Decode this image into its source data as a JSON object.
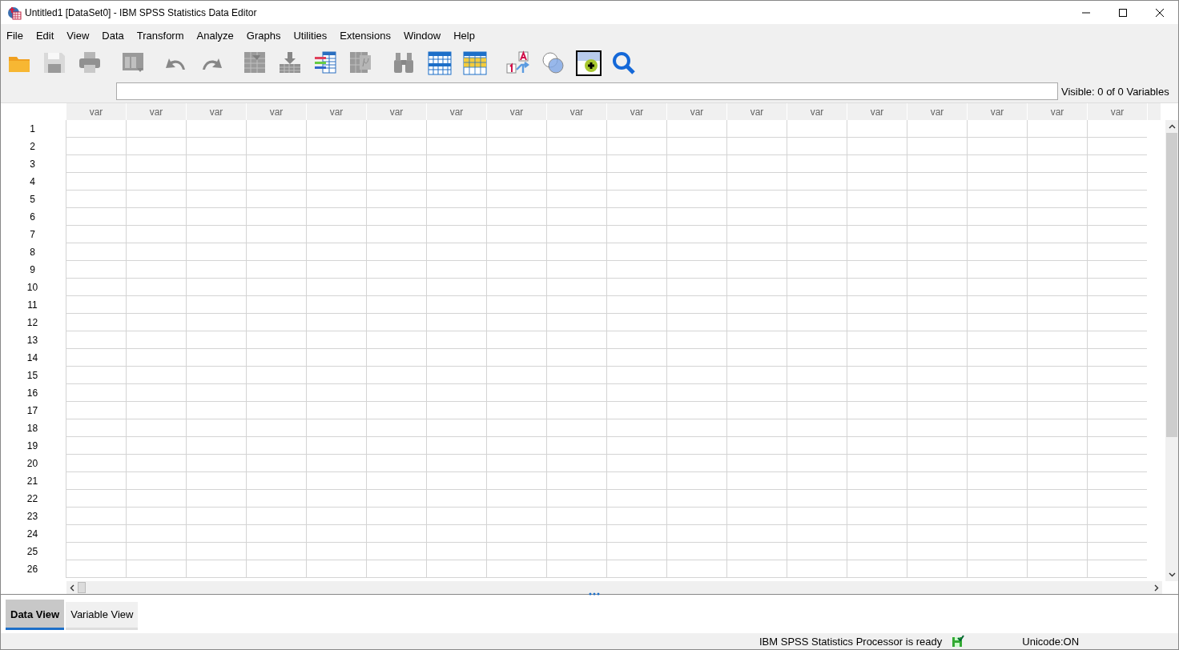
{
  "window": {
    "title": "Untitled1 [DataSet0] - IBM SPSS Statistics Data Editor"
  },
  "menu": [
    "File",
    "Edit",
    "View",
    "Data",
    "Transform",
    "Analyze",
    "Graphs",
    "Utilities",
    "Extensions",
    "Window",
    "Help"
  ],
  "toolbar": [
    {
      "kind": "open",
      "disabled": false
    },
    {
      "kind": "save",
      "disabled": true
    },
    {
      "kind": "print",
      "disabled": true
    },
    {
      "kind": "recall",
      "disabled": true
    },
    {
      "kind": "undo",
      "disabled": true
    },
    {
      "kind": "redo",
      "disabled": true
    },
    {
      "kind": "gotocase",
      "disabled": true
    },
    {
      "kind": "gotovar",
      "disabled": true
    },
    {
      "kind": "variables",
      "disabled": false
    },
    {
      "kind": "mu",
      "disabled": true
    },
    {
      "kind": "find",
      "disabled": true
    },
    {
      "kind": "insertcases",
      "disabled": false
    },
    {
      "kind": "insertvar",
      "disabled": false
    },
    {
      "kind": "labels",
      "disabled": false
    },
    {
      "kind": "sets",
      "disabled": false
    },
    {
      "kind": "usesets",
      "disabled": false
    },
    {
      "kind": "search",
      "disabled": false
    }
  ],
  "visible_count": "Visible: 0 of 0 Variables",
  "grid": {
    "columns": [
      "var",
      "var",
      "var",
      "var",
      "var",
      "var",
      "var",
      "var",
      "var",
      "var",
      "var",
      "var",
      "var",
      "var",
      "var",
      "var",
      "var",
      "var"
    ],
    "rows": [
      "1",
      "2",
      "3",
      "4",
      "5",
      "6",
      "7",
      "8",
      "9",
      "10",
      "11",
      "12",
      "13",
      "14",
      "15",
      "16",
      "17",
      "18",
      "19",
      "20",
      "21",
      "22",
      "23",
      "24",
      "25",
      "26"
    ]
  },
  "tabs": [
    {
      "label": "Data View",
      "selected": true
    },
    {
      "label": "Variable View",
      "selected": false
    }
  ],
  "status_bar": {
    "message": "IBM SPSS Statistics Processor is ready",
    "encoding": "Unicode:ON"
  }
}
